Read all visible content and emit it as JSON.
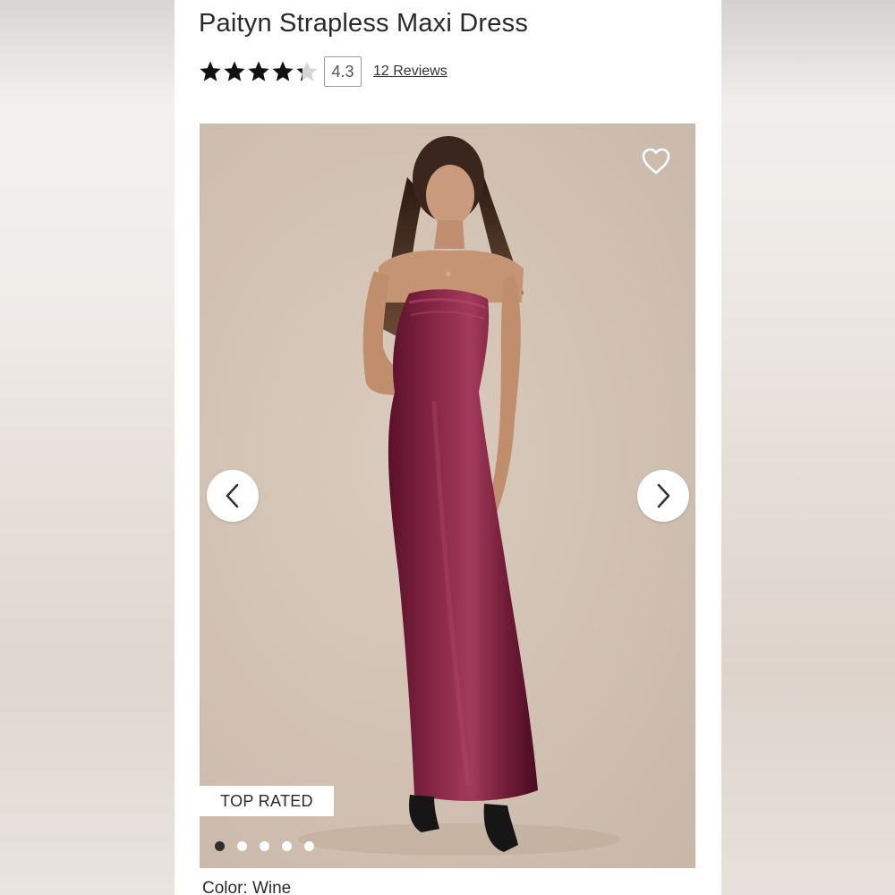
{
  "product": {
    "title": "Paityn Strapless Maxi Dress",
    "rating_value": "4.3",
    "rating_stars": 4.3,
    "reviews_label": "12 Reviews",
    "color_label": "Color: Wine"
  },
  "gallery": {
    "badge": "TOP RATED",
    "image_count": 5,
    "active_index": 0,
    "icons": {
      "favorite": "heart-icon",
      "prev": "chevron-left-icon",
      "next": "chevron-right-icon"
    }
  },
  "colors": {
    "dress": "#7a1f3d",
    "star": "#111111"
  }
}
